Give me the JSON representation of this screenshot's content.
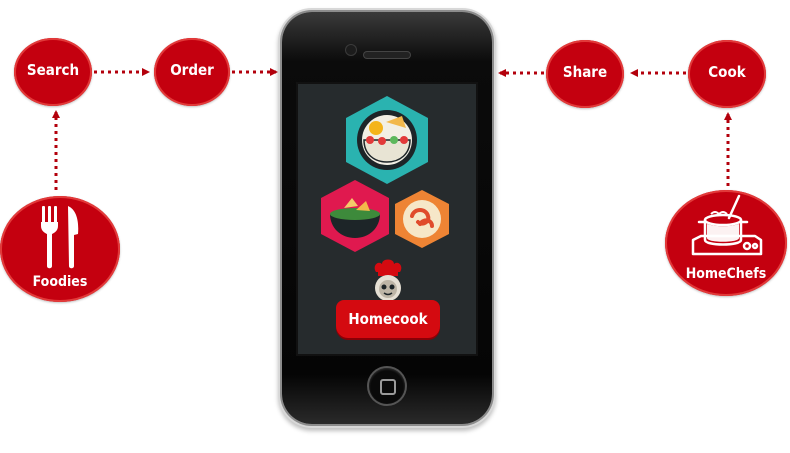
{
  "flow_left": {
    "search_label": "Search",
    "order_label": "Order",
    "foodies_label": "Foodies"
  },
  "flow_right": {
    "share_label": "Share",
    "cook_label": "Cook",
    "homechefs_label": "HomeChefs"
  },
  "phone": {
    "cta_label": "Homecook"
  },
  "colors": {
    "node_red": "#c4000f",
    "arrow_red": "#b3000c",
    "hex_teal": "#2ab3b0",
    "hex_magenta": "#e0194f",
    "hex_orange": "#ee8434",
    "screen_bg": "#262b2d"
  },
  "icons": [
    "fork-knife-icon",
    "cooking-pot-icon",
    "salad-bowl-icon",
    "soup-bowl-icon",
    "shrimp-plate-icon",
    "chef-mascot-icon",
    "home-button-icon"
  ]
}
